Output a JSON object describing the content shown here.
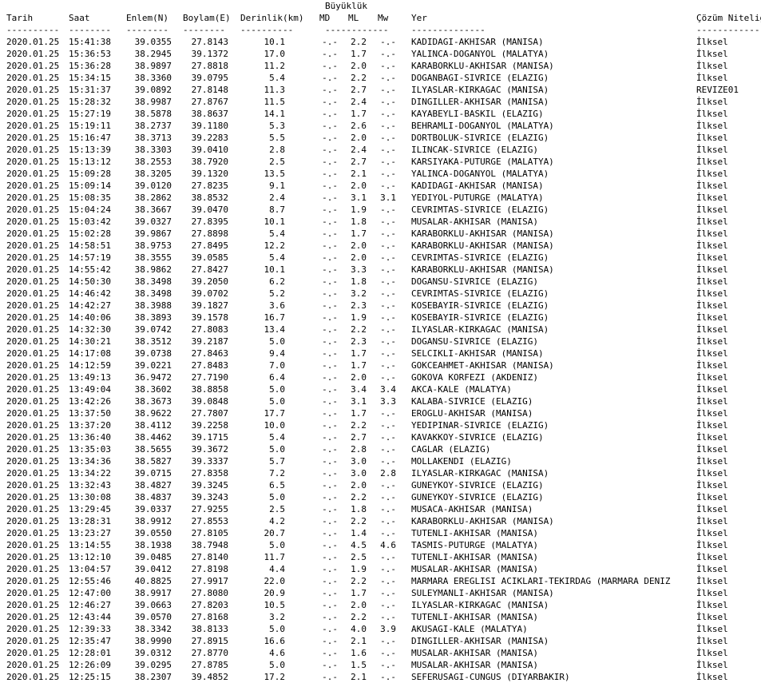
{
  "header": {
    "magnitude_group": "Büyüklük",
    "columns": {
      "date": "Tarih",
      "time": "Saat",
      "lat": "Enlem(N)",
      "lon": "Boylam(E)",
      "depth": "Derinlik(km)",
      "md": "MD",
      "ml": "ML",
      "mw": "Mw",
      "location": "Yer",
      "quality": "Çözüm Niteliği"
    },
    "rules": {
      "date": "----------",
      "time": "--------",
      "lat": "--------",
      "lon": "--------",
      "depth": "----------",
      "mag": "------------",
      "location": "--------------",
      "quality": "------------"
    }
  },
  "rows": [
    {
      "date": "2020.01.25",
      "time": "15:41:38",
      "lat": "39.0355",
      "lon": "27.8143",
      "depth": "10.1",
      "md": "-.-",
      "ml": "2.2",
      "mw": "-.-",
      "location": "KADIDAGI-AKHISAR (MANISA)",
      "quality": "İlksel"
    },
    {
      "date": "2020.01.25",
      "time": "15:36:53",
      "lat": "38.2945",
      "lon": "39.1372",
      "depth": "17.0",
      "md": "-.-",
      "ml": "1.7",
      "mw": "-.-",
      "location": "YALINCA-DOGANYOL (MALATYA)",
      "quality": "İlksel"
    },
    {
      "date": "2020.01.25",
      "time": "15:36:28",
      "lat": "38.9897",
      "lon": "27.8818",
      "depth": "11.2",
      "md": "-.-",
      "ml": "2.0",
      "mw": "-.-",
      "location": "KARABORKLU-AKHISAR (MANISA)",
      "quality": "İlksel"
    },
    {
      "date": "2020.01.25",
      "time": "15:34:15",
      "lat": "38.3360",
      "lon": "39.0795",
      "depth": "5.4",
      "md": "-.-",
      "ml": "2.2",
      "mw": "-.-",
      "location": "DOGANBAGI-SIVRICE (ELAZIG)",
      "quality": "İlksel"
    },
    {
      "date": "2020.01.25",
      "time": "15:31:37",
      "lat": "39.0892",
      "lon": "27.8148",
      "depth": "11.3",
      "md": "-.-",
      "ml": "2.7",
      "mw": "-.-",
      "location": "ILYASLAR-KIRKAGAC (MANISA)",
      "quality": "REVIZE01"
    },
    {
      "date": "2020.01.25",
      "time": "15:28:32",
      "lat": "38.9987",
      "lon": "27.8767",
      "depth": "11.5",
      "md": "-.-",
      "ml": "2.4",
      "mw": "-.-",
      "location": "DINGILLER-AKHISAR (MANISA)",
      "quality": "İlksel"
    },
    {
      "date": "2020.01.25",
      "time": "15:27:19",
      "lat": "38.5878",
      "lon": "38.8637",
      "depth": "14.1",
      "md": "-.-",
      "ml": "1.7",
      "mw": "-.-",
      "location": "KAYABEYLI-BASKIL (ELAZIG)",
      "quality": "İlksel"
    },
    {
      "date": "2020.01.25",
      "time": "15:19:11",
      "lat": "38.2737",
      "lon": "39.1180",
      "depth": "5.3",
      "md": "-.-",
      "ml": "2.6",
      "mw": "-.-",
      "location": "BEHRAMLI-DOGANYOL (MALATYA)",
      "quality": "İlksel"
    },
    {
      "date": "2020.01.25",
      "time": "15:16:47",
      "lat": "38.3713",
      "lon": "39.2283",
      "depth": "5.5",
      "md": "-.-",
      "ml": "2.0",
      "mw": "-.-",
      "location": "DORTBOLUK-SIVRICE (ELAZIG)",
      "quality": "İlksel"
    },
    {
      "date": "2020.01.25",
      "time": "15:13:39",
      "lat": "38.3303",
      "lon": "39.0410",
      "depth": "2.8",
      "md": "-.-",
      "ml": "2.4",
      "mw": "-.-",
      "location": "ILINCAK-SIVRICE (ELAZIG)",
      "quality": "İlksel"
    },
    {
      "date": "2020.01.25",
      "time": "15:13:12",
      "lat": "38.2553",
      "lon": "38.7920",
      "depth": "2.5",
      "md": "-.-",
      "ml": "2.7",
      "mw": "-.-",
      "location": "KARSIYAKA-PUTURGE (MALATYA)",
      "quality": "İlksel"
    },
    {
      "date": "2020.01.25",
      "time": "15:09:28",
      "lat": "38.3205",
      "lon": "39.1320",
      "depth": "13.5",
      "md": "-.-",
      "ml": "2.1",
      "mw": "-.-",
      "location": "YALINCA-DOGANYOL (MALATYA)",
      "quality": "İlksel"
    },
    {
      "date": "2020.01.25",
      "time": "15:09:14",
      "lat": "39.0120",
      "lon": "27.8235",
      "depth": "9.1",
      "md": "-.-",
      "ml": "2.0",
      "mw": "-.-",
      "location": "KADIDAGI-AKHISAR (MANISA)",
      "quality": "İlksel"
    },
    {
      "date": "2020.01.25",
      "time": "15:08:35",
      "lat": "38.2862",
      "lon": "38.8532",
      "depth": "2.4",
      "md": "-.-",
      "ml": "3.1",
      "mw": "3.1",
      "location": "YEDIYOL-PUTURGE (MALATYA)",
      "quality": "İlksel"
    },
    {
      "date": "2020.01.25",
      "time": "15:04:24",
      "lat": "38.3667",
      "lon": "39.0470",
      "depth": "8.7",
      "md": "-.-",
      "ml": "1.9",
      "mw": "-.-",
      "location": "CEVRIMTAS-SIVRICE (ELAZIG)",
      "quality": "İlksel"
    },
    {
      "date": "2020.01.25",
      "time": "15:03:42",
      "lat": "39.0327",
      "lon": "27.8395",
      "depth": "10.1",
      "md": "-.-",
      "ml": "1.8",
      "mw": "-.-",
      "location": "MUSALAR-AKHISAR (MANISA)",
      "quality": "İlksel"
    },
    {
      "date": "2020.01.25",
      "time": "15:02:28",
      "lat": "39.9867",
      "lon": "27.8898",
      "depth": "5.4",
      "md": "-.-",
      "ml": "1.7",
      "mw": "-.-",
      "location": "KARABORKLU-AKHISAR (MANISA)",
      "quality": "İlksel"
    },
    {
      "date": "2020.01.25",
      "time": "14:58:51",
      "lat": "38.9753",
      "lon": "27.8495",
      "depth": "12.2",
      "md": "-.-",
      "ml": "2.0",
      "mw": "-.-",
      "location": "KARABORKLU-AKHISAR (MANISA)",
      "quality": "İlksel"
    },
    {
      "date": "2020.01.25",
      "time": "14:57:19",
      "lat": "38.3555",
      "lon": "39.0585",
      "depth": "5.4",
      "md": "-.-",
      "ml": "2.0",
      "mw": "-.-",
      "location": "CEVRIMTAS-SIVRICE (ELAZIG)",
      "quality": "İlksel"
    },
    {
      "date": "2020.01.25",
      "time": "14:55:42",
      "lat": "38.9862",
      "lon": "27.8427",
      "depth": "10.1",
      "md": "-.-",
      "ml": "3.3",
      "mw": "-.-",
      "location": "KARABORKLU-AKHISAR (MANISA)",
      "quality": "İlksel"
    },
    {
      "date": "2020.01.25",
      "time": "14:50:30",
      "lat": "38.3498",
      "lon": "39.2050",
      "depth": "6.2",
      "md": "-.-",
      "ml": "1.8",
      "mw": "-.-",
      "location": "DOGANSU-SIVRICE (ELAZIG)",
      "quality": "İlksel"
    },
    {
      "date": "2020.01.25",
      "time": "14:46:42",
      "lat": "38.3498",
      "lon": "39.0702",
      "depth": "5.2",
      "md": "-.-",
      "ml": "3.2",
      "mw": "-.-",
      "location": "CEVRIMTAS-SIVRICE (ELAZIG)",
      "quality": "İlksel"
    },
    {
      "date": "2020.01.25",
      "time": "14:42:27",
      "lat": "38.3988",
      "lon": "39.1827",
      "depth": "3.6",
      "md": "-.-",
      "ml": "2.3",
      "mw": "-.-",
      "location": "KOSEBAYIR-SIVRICE (ELAZIG)",
      "quality": "İlksel"
    },
    {
      "date": "2020.01.25",
      "time": "14:40:06",
      "lat": "38.3893",
      "lon": "39.1578",
      "depth": "16.7",
      "md": "-.-",
      "ml": "1.9",
      "mw": "-.-",
      "location": "KOSEBAYIR-SIVRICE (ELAZIG)",
      "quality": "İlksel"
    },
    {
      "date": "2020.01.25",
      "time": "14:32:30",
      "lat": "39.0742",
      "lon": "27.8083",
      "depth": "13.4",
      "md": "-.-",
      "ml": "2.2",
      "mw": "-.-",
      "location": "ILYASLAR-KIRKAGAC (MANISA)",
      "quality": "İlksel"
    },
    {
      "date": "2020.01.25",
      "time": "14:30:21",
      "lat": "38.3512",
      "lon": "39.2187",
      "depth": "5.0",
      "md": "-.-",
      "ml": "2.3",
      "mw": "-.-",
      "location": "DOGANSU-SIVRICE (ELAZIG)",
      "quality": "İlksel"
    },
    {
      "date": "2020.01.25",
      "time": "14:17:08",
      "lat": "39.0738",
      "lon": "27.8463",
      "depth": "9.4",
      "md": "-.-",
      "ml": "1.7",
      "mw": "-.-",
      "location": "SELCIKLI-AKHISAR (MANISA)",
      "quality": "İlksel"
    },
    {
      "date": "2020.01.25",
      "time": "14:12:59",
      "lat": "39.0221",
      "lon": "27.8483",
      "depth": "7.0",
      "md": "-.-",
      "ml": "1.7",
      "mw": "-.-",
      "location": "GOKCEAHMET-AKHISAR (MANISA)",
      "quality": "İlksel"
    },
    {
      "date": "2020.01.25",
      "time": "13:49:13",
      "lat": "36.9472",
      "lon": "27.7190",
      "depth": "6.4",
      "md": "-.-",
      "ml": "2.0",
      "mw": "-.-",
      "location": "GOKOVA KORFEZI (AKDENIZ)",
      "quality": "İlksel"
    },
    {
      "date": "2020.01.25",
      "time": "13:49:04",
      "lat": "38.3602",
      "lon": "38.8858",
      "depth": "5.0",
      "md": "-.-",
      "ml": "3.4",
      "mw": "3.4",
      "location": "AKCA-KALE (MALATYA)",
      "quality": "İlksel"
    },
    {
      "date": "2020.01.25",
      "time": "13:42:26",
      "lat": "38.3673",
      "lon": "39.0848",
      "depth": "5.0",
      "md": "-.-",
      "ml": "3.1",
      "mw": "3.3",
      "location": "KALABA-SIVRICE (ELAZIG)",
      "quality": "İlksel"
    },
    {
      "date": "2020.01.25",
      "time": "13:37:50",
      "lat": "38.9622",
      "lon": "27.7807",
      "depth": "17.7",
      "md": "-.-",
      "ml": "1.7",
      "mw": "-.-",
      "location": "EROGLU-AKHISAR (MANISA)",
      "quality": "İlksel"
    },
    {
      "date": "2020.01.25",
      "time": "13:37:20",
      "lat": "38.4112",
      "lon": "39.2258",
      "depth": "10.0",
      "md": "-.-",
      "ml": "2.2",
      "mw": "-.-",
      "location": "YEDIPINAR-SIVRICE (ELAZIG)",
      "quality": "İlksel"
    },
    {
      "date": "2020.01.25",
      "time": "13:36:40",
      "lat": "38.4462",
      "lon": "39.1715",
      "depth": "5.4",
      "md": "-.-",
      "ml": "2.7",
      "mw": "-.-",
      "location": "KAVAKKOY-SIVRICE (ELAZIG)",
      "quality": "İlksel"
    },
    {
      "date": "2020.01.25",
      "time": "13:35:03",
      "lat": "38.5655",
      "lon": "39.3672",
      "depth": "5.0",
      "md": "-.-",
      "ml": "2.8",
      "mw": "-.-",
      "location": "CAGLAR (ELAZIG)",
      "quality": "İlksel"
    },
    {
      "date": "2020.01.25",
      "time": "13:34:36",
      "lat": "38.5827",
      "lon": "39.3337",
      "depth": "5.7",
      "md": "-.-",
      "ml": "3.0",
      "mw": "-.-",
      "location": "MOLLAKENDI (ELAZIG)",
      "quality": "İlksel"
    },
    {
      "date": "2020.01.25",
      "time": "13:34:22",
      "lat": "39.0715",
      "lon": "27.8358",
      "depth": "7.2",
      "md": "-.-",
      "ml": "3.0",
      "mw": "2.8",
      "location": "ILYASLAR-KIRKAGAC (MANISA)",
      "quality": "İlksel"
    },
    {
      "date": "2020.01.25",
      "time": "13:32:43",
      "lat": "38.4827",
      "lon": "39.3245",
      "depth": "6.5",
      "md": "-.-",
      "ml": "2.0",
      "mw": "-.-",
      "location": "GUNEYKOY-SIVRICE (ELAZIG)",
      "quality": "İlksel"
    },
    {
      "date": "2020.01.25",
      "time": "13:30:08",
      "lat": "38.4837",
      "lon": "39.3243",
      "depth": "5.0",
      "md": "-.-",
      "ml": "2.2",
      "mw": "-.-",
      "location": "GUNEYKOY-SIVRICE (ELAZIG)",
      "quality": "İlksel"
    },
    {
      "date": "2020.01.25",
      "time": "13:29:45",
      "lat": "39.0337",
      "lon": "27.9255",
      "depth": "2.5",
      "md": "-.-",
      "ml": "1.8",
      "mw": "-.-",
      "location": "MUSACA-AKHISAR (MANISA)",
      "quality": "İlksel"
    },
    {
      "date": "2020.01.25",
      "time": "13:28:31",
      "lat": "38.9912",
      "lon": "27.8553",
      "depth": "4.2",
      "md": "-.-",
      "ml": "2.2",
      "mw": "-.-",
      "location": "KARABORKLU-AKHISAR (MANISA)",
      "quality": "İlksel"
    },
    {
      "date": "2020.01.25",
      "time": "13:23:27",
      "lat": "39.0550",
      "lon": "27.8105",
      "depth": "20.7",
      "md": "-.-",
      "ml": "1.4",
      "mw": "-.-",
      "location": "TUTENLI-AKHISAR (MANISA)",
      "quality": "İlksel"
    },
    {
      "date": "2020.01.25",
      "time": "13:14:55",
      "lat": "38.1938",
      "lon": "38.7948",
      "depth": "5.0",
      "md": "-.-",
      "ml": "4.5",
      "mw": "4.6",
      "location": "TASMIS-PUTURGE (MALATYA)",
      "quality": "İlksel"
    },
    {
      "date": "2020.01.25",
      "time": "13:12:10",
      "lat": "39.0485",
      "lon": "27.8140",
      "depth": "11.7",
      "md": "-.-",
      "ml": "2.5",
      "mw": "-.-",
      "location": "TUTENLI-AKHISAR (MANISA)",
      "quality": "İlksel"
    },
    {
      "date": "2020.01.25",
      "time": "13:04:57",
      "lat": "39.0412",
      "lon": "27.8198",
      "depth": "4.4",
      "md": "-.-",
      "ml": "1.9",
      "mw": "-.-",
      "location": "MUSALAR-AKHISAR (MANISA)",
      "quality": "İlksel"
    },
    {
      "date": "2020.01.25",
      "time": "12:55:46",
      "lat": "40.8825",
      "lon": "27.9917",
      "depth": "22.0",
      "md": "-.-",
      "ml": "2.2",
      "mw": "-.-",
      "location": "MARMARA EREGLISI ACIKLARI-TEKIRDAG (MARMARA DENIZ",
      "quality": "İlksel"
    },
    {
      "date": "2020.01.25",
      "time": "12:47:00",
      "lat": "38.9917",
      "lon": "27.8080",
      "depth": "20.9",
      "md": "-.-",
      "ml": "1.7",
      "mw": "-.-",
      "location": "SULEYMANLI-AKHISAR (MANISA)",
      "quality": "İlksel"
    },
    {
      "date": "2020.01.25",
      "time": "12:46:27",
      "lat": "39.0663",
      "lon": "27.8203",
      "depth": "10.5",
      "md": "-.-",
      "ml": "2.0",
      "mw": "-.-",
      "location": "ILYASLAR-KIRKAGAC (MANISA)",
      "quality": "İlksel"
    },
    {
      "date": "2020.01.25",
      "time": "12:43:44",
      "lat": "39.0570",
      "lon": "27.8168",
      "depth": "3.2",
      "md": "-.-",
      "ml": "2.2",
      "mw": "-.-",
      "location": "TUTENLI-AKHISAR (MANISA)",
      "quality": "İlksel"
    },
    {
      "date": "2020.01.25",
      "time": "12:39:33",
      "lat": "38.3342",
      "lon": "38.8133",
      "depth": "5.0",
      "md": "-.-",
      "ml": "4.0",
      "mw": "3.9",
      "location": "AKUSAGI-KALE (MALATYA)",
      "quality": "İlksel"
    },
    {
      "date": "2020.01.25",
      "time": "12:35:47",
      "lat": "38.9990",
      "lon": "27.8915",
      "depth": "16.6",
      "md": "-.-",
      "ml": "2.1",
      "mw": "-.-",
      "location": "DINGILLER-AKHISAR (MANISA)",
      "quality": "İlksel"
    },
    {
      "date": "2020.01.25",
      "time": "12:28:01",
      "lat": "39.0312",
      "lon": "27.8770",
      "depth": "4.6",
      "md": "-.-",
      "ml": "1.6",
      "mw": "-.-",
      "location": "MUSALAR-AKHISAR (MANISA)",
      "quality": "İlksel"
    },
    {
      "date": "2020.01.25",
      "time": "12:26:09",
      "lat": "39.0295",
      "lon": "27.8785",
      "depth": "5.0",
      "md": "-.-",
      "ml": "1.5",
      "mw": "-.-",
      "location": "MUSALAR-AKHISAR (MANISA)",
      "quality": "İlksel"
    },
    {
      "date": "2020.01.25",
      "time": "12:25:15",
      "lat": "38.2307",
      "lon": "39.4852",
      "depth": "17.2",
      "md": "-.-",
      "ml": "2.1",
      "mw": "-.-",
      "location": "SEFERUSAGI-CUNGUS (DIYARBAKIR)",
      "quality": "İlksel"
    }
  ]
}
